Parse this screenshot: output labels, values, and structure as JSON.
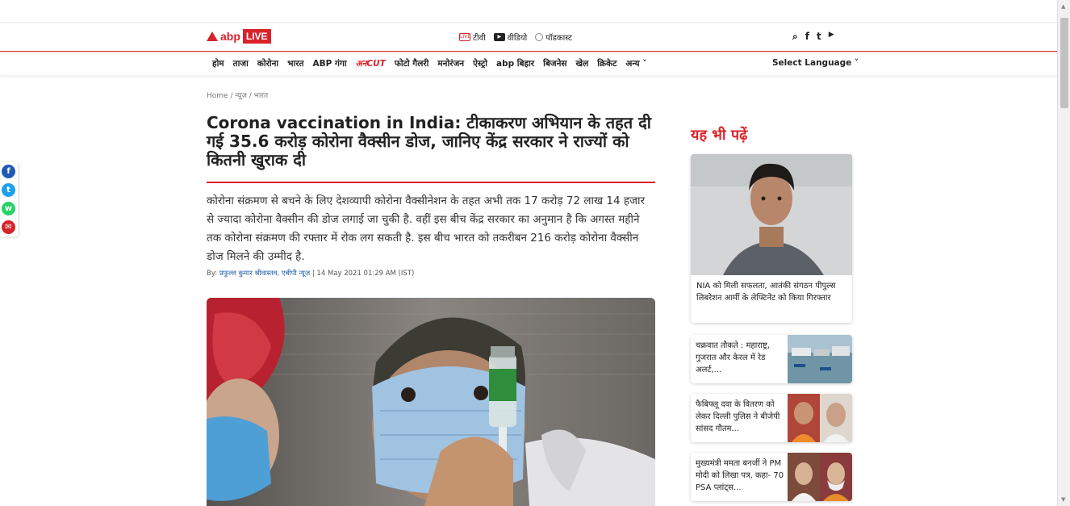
{
  "header": {
    "logo_text": "abp",
    "logo_badge": "LIVE",
    "media": [
      {
        "icon": "tv-icon",
        "icon_label": "LIVE",
        "label": "टीवी"
      },
      {
        "icon": "video-icon",
        "icon_label": "▶",
        "label": "वीडियो"
      },
      {
        "icon": "podcast-icon",
        "icon_label": "",
        "label": "पॉडकास्ट"
      }
    ],
    "social": [
      {
        "icon": "search-icon",
        "glyph": "⌕"
      },
      {
        "icon": "facebook-icon",
        "glyph": "f"
      },
      {
        "icon": "twitter-icon",
        "glyph": "t"
      },
      {
        "icon": "youtube-icon",
        "glyph": "▶"
      }
    ]
  },
  "nav": {
    "items": [
      "होम",
      "ताजा",
      "कोरोना",
      "भारत",
      "ABP गंगा",
      "अनCUT",
      "फोटो गैलरी",
      "मनोरंजन",
      "ऐस्ट्रो",
      "abp बिहार",
      "बिजनेस",
      "खेल",
      "क्रिकेट",
      "अन्य ˅"
    ],
    "language": "Select Language ˅"
  },
  "share": [
    {
      "icon": "facebook-share-icon",
      "color": "#1e5bb8",
      "glyph": "f"
    },
    {
      "icon": "twitter-share-icon",
      "color": "#1da1f2",
      "glyph": "t"
    },
    {
      "icon": "whatsapp-share-icon",
      "color": "#25d366",
      "glyph": "w"
    },
    {
      "icon": "mail-share-icon",
      "color": "#d8232a",
      "glyph": "✉"
    }
  ],
  "article": {
    "breadcrumb": "Home  /  न्यूज़ / भारत",
    "title": "Corona vaccination in India: टीकाकरण अभियान के तहत दी गई 35.6 करोड़ कोरोना वैक्सीन डोज, जानिए केंद्र सरकार ने राज्यों को कितनी खुराक दी",
    "summary": "कोरोना संक्रमण से बचने के लिए देशव्यापी कोरोना वैक्सीनेशन के तहत अभी तक 17 करोड़ 72 लाख 14 हजार से ज्यादा कोरोना वैक्सीन की डोज लगाई जा चुकी है. वहीं इस बीच केंद्र सरकार का अनुमान है कि अगस्त महीने तक कोरोना संक्रमण की रफ्तार में रोक लग सकती है. इस बीच भारत को तकरीबन 216 करोड़ कोरोना वैक्सीन डोज मिलने की उम्मीद है.",
    "byline_prefix": "By: ",
    "author": "प्रफुल्ल कुमार श्रीवास्तव, एबीपी न्यूज़",
    "date": " | 14 May 2021 01:29 AM (IST)"
  },
  "sidebar": {
    "heading": "यह भी पढ़ें",
    "featured": "NIA को मिली सफलता, आतंकी संगठन पीपुल्स लिबरेशन आर्मी के लेफ्टिनेंट को किया गिरफ्तार",
    "cards": [
      "चक्रवात तौकते : महाराष्ट्र, गुजरात  और केरल में रेड अलर्ट,...",
      "फैबिफ्लू दवा के वितरण को लेकर दिल्ली पुलिस ने बीजेपी सांसद गौतम...",
      "मुख्यमंत्री ममता बनर्जी ने PM मोदी को लिखा पत्र, कहा- 70 PSA प्लांट्स..."
    ]
  }
}
